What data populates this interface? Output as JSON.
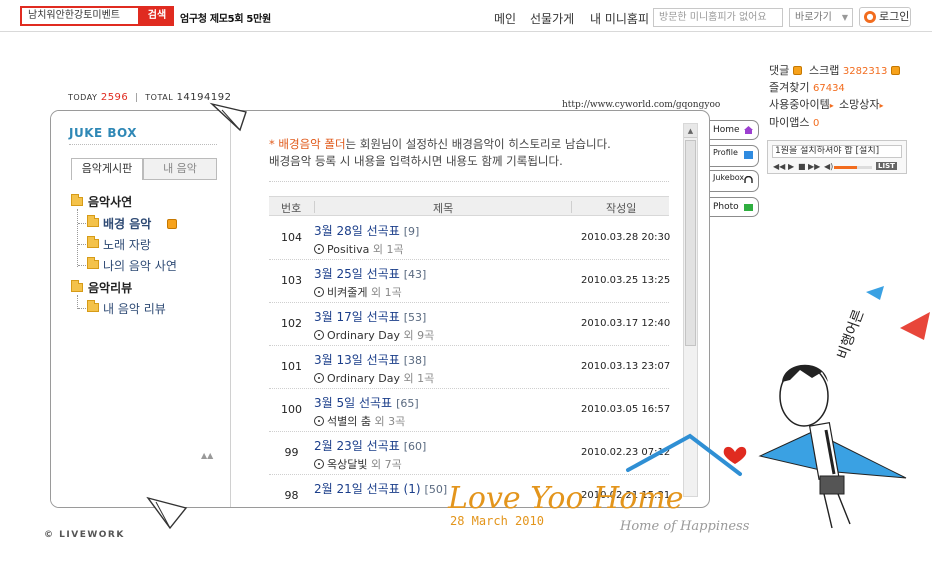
{
  "header": {
    "search_value": "남치워안한강토미벤트",
    "search_button": "검색",
    "trending": "엄구청 제모5회 5만원",
    "nav": [
      "메인",
      "선물가게",
      "내 미니홈피"
    ],
    "visit_placeholder": "방문한 미니홈피가 없어요",
    "shortcut_label": "바로가기",
    "login_label": "로그인"
  },
  "counter": {
    "today_label": "TODAY",
    "today_value": "2596",
    "total_label": "TOTAL",
    "total_value": "14194192"
  },
  "url": "http://www.cyworld.com/gqongyoo",
  "sidebar": {
    "title": "JUKE BOX",
    "tabs": [
      "음악게시판",
      "내 음악"
    ],
    "tree": [
      {
        "label": "음악사연",
        "level": 0
      },
      {
        "label": "배경 음악",
        "level": 1,
        "selected": true
      },
      {
        "label": "노래 자랑",
        "level": 1
      },
      {
        "label": "나의 음악 사연",
        "level": 1
      },
      {
        "label": "음악리뷰",
        "level": 0
      },
      {
        "label": "내 음악 리뷰",
        "level": 1
      }
    ]
  },
  "notice": {
    "star": "*",
    "highlight": "배경음악 폴더",
    "line1": "는 회원님이 설정하신 배경음악이 히스토리로 남습니다.",
    "line2": "배경음악 등록 시 내용을 입력하시면 내용도 함께 기록됩니다."
  },
  "table": {
    "headers": [
      "번호",
      "제목",
      "작성일"
    ],
    "rows": [
      {
        "no": "104",
        "title": "3월 28일 선곡표",
        "count": "[9]",
        "song": "Positiva",
        "extra": "외 1곡",
        "date": "2010.03.28 20:30"
      },
      {
        "no": "103",
        "title": "3월 25일 선곡표",
        "count": "[43]",
        "song": "비켜줄게",
        "extra": "외 1곡",
        "date": "2010.03.25 13:25"
      },
      {
        "no": "102",
        "title": "3월 17일 선곡표",
        "count": "[53]",
        "song": "Ordinary Day",
        "extra": "외 9곡",
        "date": "2010.03.17 12:40"
      },
      {
        "no": "101",
        "title": "3월 13일 선곡표",
        "count": "[38]",
        "song": "Ordinary Day",
        "extra": "외 1곡",
        "date": "2010.03.13 23:07"
      },
      {
        "no": "100",
        "title": "3월 5일 선곡표",
        "count": "[65]",
        "song": "석별의 춤",
        "extra": "외 3곡",
        "date": "2010.03.05 16:57"
      },
      {
        "no": "99",
        "title": "2월 23일 선곡표",
        "count": "[60]",
        "song": "옥상달빛",
        "extra": "외 7곡",
        "date": "2010.02.23 07:12"
      },
      {
        "no": "98",
        "title": "2월 21일 선곡표 (1)",
        "count": "[50]",
        "song": "",
        "extra": "",
        "date": "2010.02.21 15:31"
      }
    ]
  },
  "menu_tabs": [
    "Home",
    "Profile",
    "Jukebox",
    "Photo"
  ],
  "right": {
    "comment": "댓글",
    "scrap": "스크랩",
    "scrap_count": "3282313",
    "favorites": "즐겨찾기",
    "favorites_count": "67434",
    "items": "사용중아이템",
    "wishbox": "소망상자",
    "myapps": "마이앱스",
    "myapps_count": "0",
    "player_msg": "1원을 설치하셔야 합 [설치]",
    "player_list": "LIST"
  },
  "footer": {
    "livework": "LIVEWORK"
  },
  "deco": {
    "date": "28 March 2010",
    "brand": "Love Yoo Home",
    "tagline": "Home of Happiness",
    "figure_text": "비행어른"
  },
  "colors": {
    "accent": "#e02b20",
    "orange": "#f26c1e",
    "title_blue": "#2f88b6",
    "link_blue": "#1b3e8a"
  }
}
